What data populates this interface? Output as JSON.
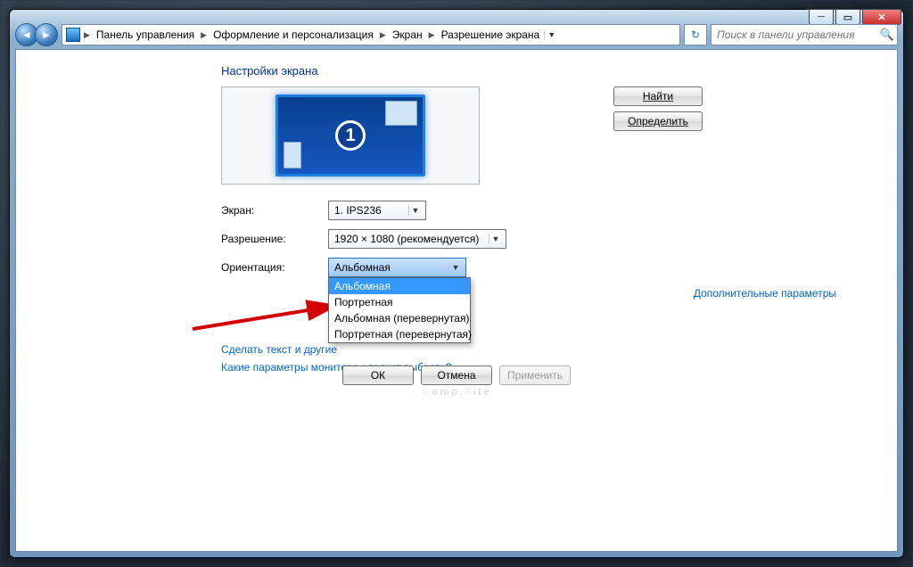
{
  "breadcrumb": {
    "items": [
      "Панель управления",
      "Оформление и персонализация",
      "Экран",
      "Разрешение экрана"
    ]
  },
  "search": {
    "placeholder": "Поиск в панели управления"
  },
  "page": {
    "title": "Настройки экрана"
  },
  "preview": {
    "display_number": "1"
  },
  "side_buttons": {
    "find": "Найти",
    "detect": "Определить"
  },
  "form": {
    "screen": {
      "label": "Экран:",
      "value": "1. IPS236"
    },
    "resolution": {
      "label": "Разрешение:",
      "value": "1920 × 1080 (рекомендуется)"
    },
    "orientation": {
      "label": "Ориентация:",
      "value": "Альбомная",
      "options": [
        "Альбомная",
        "Портретная",
        "Альбомная (перевернутая)",
        "Портретная (перевернутая)"
      ]
    }
  },
  "links": {
    "advanced": "Дополнительные параметры",
    "text_size": "Сделать текст и другие",
    "which_params": "Какие параметры монитора следует выбрать?"
  },
  "buttons": {
    "ok": "ОК",
    "cancel": "Отмена",
    "apply": "Применить"
  },
  "watermark": {
    "k": "K",
    "mid": "omp.",
    "s": "S",
    "tail": "ite"
  }
}
